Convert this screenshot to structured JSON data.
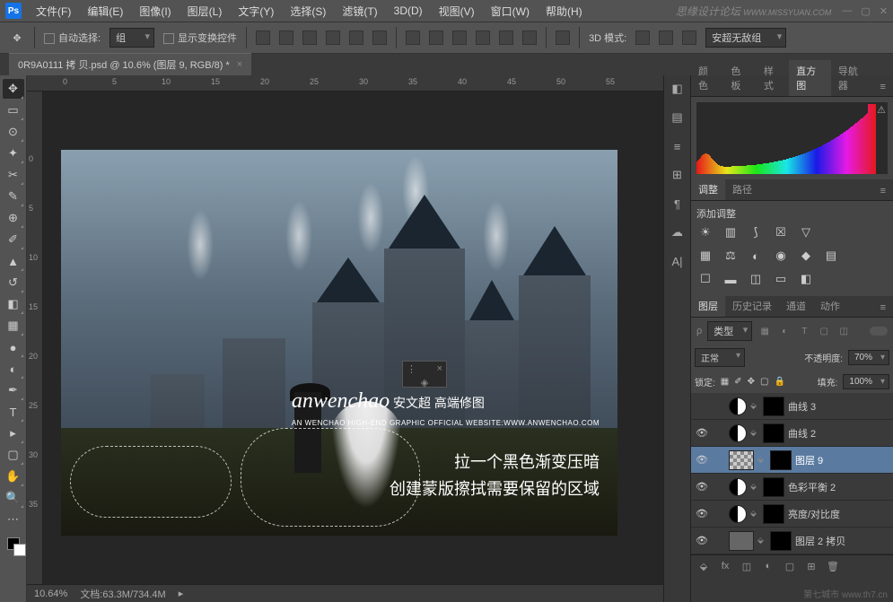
{
  "menubar": {
    "items": [
      "文件(F)",
      "编辑(E)",
      "图像(I)",
      "图层(L)",
      "文字(Y)",
      "选择(S)",
      "滤镜(T)",
      "3D(D)",
      "视图(V)",
      "窗口(W)",
      "帮助(H)"
    ],
    "brand": "思缘设计论坛",
    "brand_url": "WWW.MISSYUAN.COM"
  },
  "optbar": {
    "auto_select": "自动选择:",
    "group": "组",
    "show_transform": "显示变换控件",
    "mode_3d": "3D 模式:",
    "group_name": "安超无敌组"
  },
  "doctab": {
    "title": "0R9A0111 拷 贝.psd @ 10.6% (图层 9, RGB/8) *"
  },
  "ruler_h": [
    "0",
    "5",
    "10",
    "15",
    "20",
    "25",
    "30",
    "35",
    "40",
    "45",
    "50",
    "55"
  ],
  "ruler_v": [
    "0",
    "5",
    "10",
    "15",
    "20",
    "25",
    "30",
    "35"
  ],
  "canvas": {
    "watermark_script": "anwenchao",
    "watermark_cn": "安文超 高端修图",
    "watermark_sub": "AN WENCHAO HIGH-END GRAPHIC OFFICIAL WEBSITE:WWW.ANWENCHAO.COM",
    "annot1": "拉一个黑色渐变压暗",
    "annot2": "创建蒙版擦拭需要保留的区域"
  },
  "statusbar": {
    "zoom": "10.64%",
    "doc": "文档:63.3M/734.4M"
  },
  "panels": {
    "hist_tabs": [
      "颜色",
      "色板",
      "样式",
      "直方图",
      "导航器"
    ],
    "hist_active": 3,
    "adj_tabs": [
      "调整",
      "路径"
    ],
    "adj_title": "添加调整",
    "layer_tabs": [
      "图层",
      "历史记录",
      "通道",
      "动作"
    ],
    "kind_label": "类型",
    "blend": "正常",
    "opacity_label": "不透明度:",
    "opacity_val": "70%",
    "lock_label": "锁定:",
    "fill_label": "填充:",
    "fill_val": "100%",
    "layers": [
      {
        "vis": false,
        "adj": true,
        "mask": true,
        "name": "曲线 3"
      },
      {
        "vis": true,
        "adj": true,
        "mask": true,
        "name": "曲线 2"
      },
      {
        "vis": true,
        "thumb": "checker",
        "mask": true,
        "name": "图层 9",
        "active": true
      },
      {
        "vis": true,
        "adj": true,
        "mask": true,
        "name": "色彩平衡 2"
      },
      {
        "vis": true,
        "adj": true,
        "mask": true,
        "name": "亮度/对比度"
      },
      {
        "vis": true,
        "thumb": "img",
        "mask": true,
        "name": "图层 2 拷贝"
      }
    ]
  },
  "footer_wm": "第七城市  www.th7.cn"
}
